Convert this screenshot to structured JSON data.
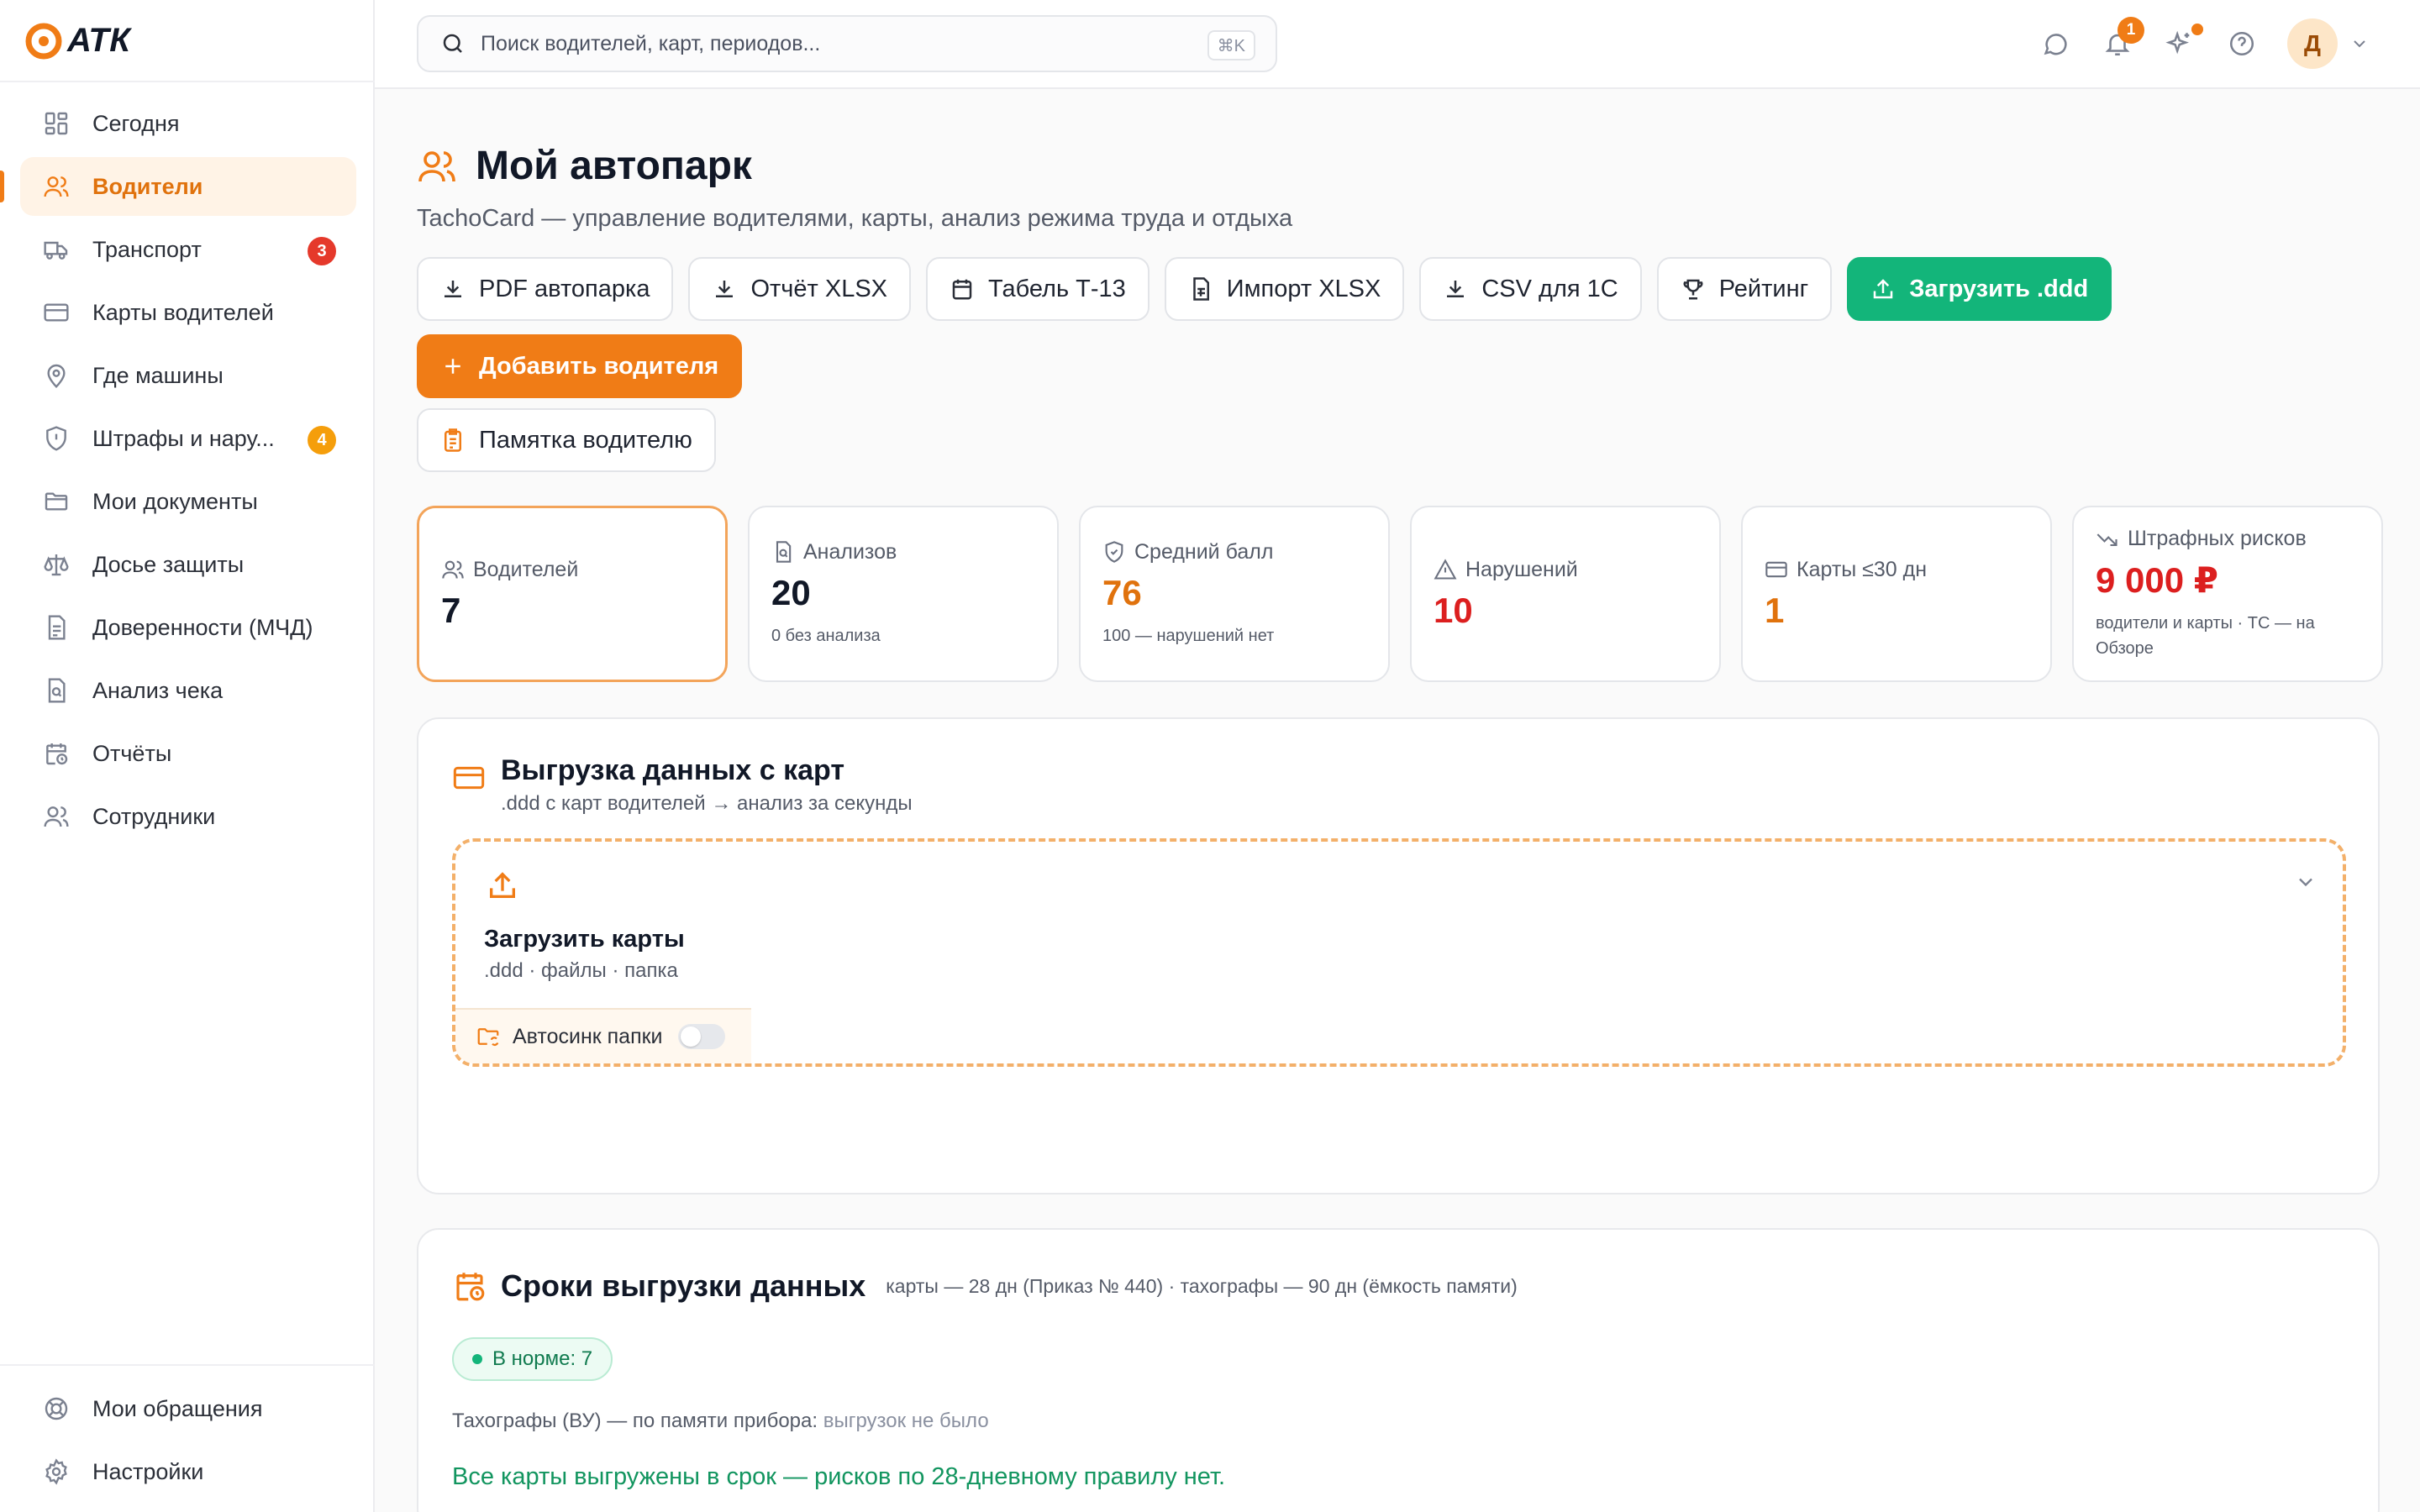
{
  "brand": {
    "logo_text": "АТК"
  },
  "sidebar": {
    "items": [
      {
        "label": "Сегодня",
        "icon": "dashboard-icon"
      },
      {
        "label": "Водители",
        "icon": "users-icon",
        "active": true
      },
      {
        "label": "Транспорт",
        "icon": "truck-icon",
        "badge": "3",
        "badge_color": "#e5392b"
      },
      {
        "label": "Карты водителей",
        "icon": "card-icon"
      },
      {
        "label": "Где машины",
        "icon": "map-pin-icon"
      },
      {
        "label": "Штрафы и нару...",
        "icon": "shield-alert-icon",
        "badge": "4",
        "badge_color": "#f59e0b"
      },
      {
        "label": "Мои документы",
        "icon": "folder-icon"
      },
      {
        "label": "Досье защиты",
        "icon": "scales-icon"
      },
      {
        "label": "Доверенности (МЧД)",
        "icon": "document-icon"
      },
      {
        "label": "Анализ чека",
        "icon": "receipt-search-icon"
      },
      {
        "label": "Отчёты",
        "icon": "calendar-clock-icon"
      },
      {
        "label": "Сотрудники",
        "icon": "user-group-icon"
      }
    ],
    "bottom_items": [
      {
        "label": "Мои обращения",
        "icon": "lifebuoy-icon"
      },
      {
        "label": "Настройки",
        "icon": "gear-icon"
      }
    ]
  },
  "topbar": {
    "search_placeholder": "Поиск водителей, карт, периодов...",
    "search_shortcut": "⌘K",
    "notifications_count": "1",
    "avatar_initial": "Д"
  },
  "page": {
    "title": "Мой автопарк",
    "subtitle": "TachoCard — управление водителями, карты, анализ режима труда и отдыха"
  },
  "actions": {
    "pdf": "PDF автопарка",
    "xlsx_report": "Отчёт XLSX",
    "timesheet": "Табель Т-13",
    "import_xlsx": "Импорт XLSX",
    "csv_1c": "CSV для 1С",
    "rating": "Рейтинг",
    "upload_ddd": "Загрузить .ddd",
    "add_driver": "Добавить водителя",
    "memo": "Памятка водителю"
  },
  "kpis": [
    {
      "label": "Водителей",
      "value": "7",
      "note": ""
    },
    {
      "label": "Анализов",
      "value": "20",
      "note": "0 без анализа"
    },
    {
      "label": "Средний балл",
      "value": "76",
      "note": "100 — нарушений нет"
    },
    {
      "label": "Нарушений",
      "value": "10",
      "note": ""
    },
    {
      "label": "Карты ≤30 дн",
      "value": "1",
      "note": ""
    },
    {
      "label": "Штрафных рисков",
      "value": "9 000 ₽",
      "note": "водители и карты · ТС — на Обзоре"
    }
  ],
  "upload": {
    "title": "Выгрузка данных с карт",
    "subtitle": ".ddd с карт водителей → анализ за секунды",
    "dropzone_title": "Загрузить карты",
    "dropzone_sub": ".ddd · файлы · папка",
    "autosync_label": "Автосинк папки",
    "autosync_on": false
  },
  "deadlines": {
    "title": "Сроки выгрузки данных",
    "subtitle": "карты — 28 дн (Приказ № 440) · тахографы — 90 дн (ёмкость памяти)",
    "status_pill": "В норме: 7",
    "vu_label": "Тахографы (ВУ) — по памяти прибора:",
    "vu_value": "выгрузок не было",
    "ok_message": "Все карты выгружены в срок — рисков по 28-дневному правилу нет."
  },
  "colors": {
    "accent": "#f07c16",
    "success": "#13b57a",
    "danger": "#dc1f1f"
  }
}
